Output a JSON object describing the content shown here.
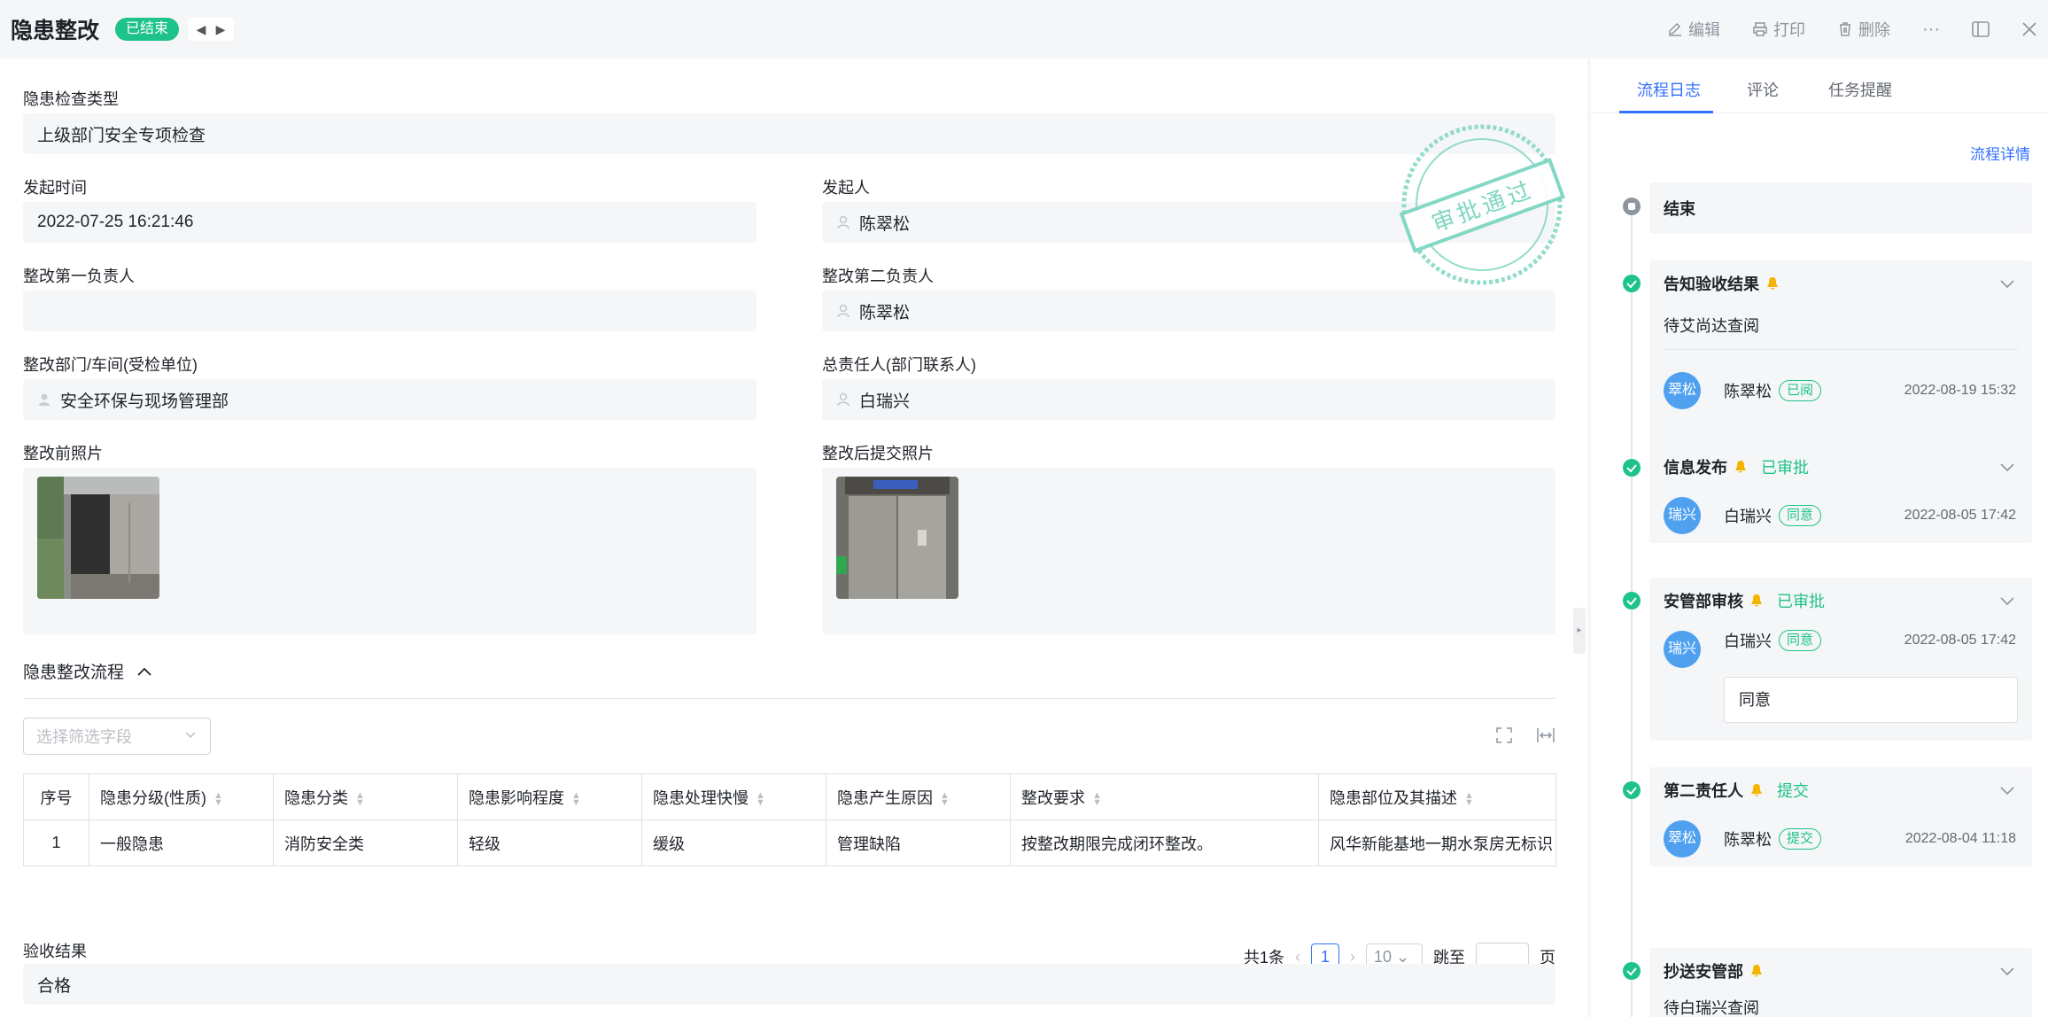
{
  "header": {
    "title": "隐患整改",
    "status": "已结束",
    "actions": {
      "edit": "编辑",
      "print": "打印",
      "delete": "删除"
    },
    "more": "···"
  },
  "form": {
    "check_type": {
      "label": "隐患检查类型",
      "value": "上级部门安全专项检查"
    },
    "start_time": {
      "label": "发起时间",
      "value": "2022-07-25 16:21:46"
    },
    "initiator": {
      "label": "发起人",
      "value": "陈翠松"
    },
    "first_owner": {
      "label": "整改第一负责人",
      "value": ""
    },
    "second_owner": {
      "label": "整改第二负责人",
      "value": "陈翠松"
    },
    "department": {
      "label": "整改部门/车间(受检单位)",
      "value": "安全环保与现场管理部"
    },
    "chief": {
      "label": "总责任人(部门联系人)",
      "value": "白瑞兴"
    },
    "before_photo": {
      "label": "整改前照片"
    },
    "after_photo": {
      "label": "整改后提交照片"
    },
    "acceptance": {
      "label": "验收结果",
      "value": "合格"
    }
  },
  "stamp": {
    "text": "审批通过"
  },
  "process_section": {
    "title": "隐患整改流程",
    "filter_placeholder": "选择筛选字段",
    "columns": [
      "序号",
      "隐患分级(性质)",
      "隐患分类",
      "隐患影响程度",
      "隐患处理快慢",
      "隐患产生原因",
      "整改要求",
      "隐患部位及其描述"
    ],
    "rows": [
      [
        "1",
        "一般隐患",
        "消防安全类",
        "轻级",
        "缓级",
        "管理缺陷",
        "按整改期限完成闭环整改。",
        "风华新能基地一期水泵房无标识"
      ]
    ]
  },
  "pager": {
    "total": "共1条",
    "current": "1",
    "page_size": "10",
    "jump": "跳至",
    "page_unit": "页"
  },
  "side": {
    "tabs": [
      "流程日志",
      "评论",
      "任务提醒"
    ],
    "flow_detail": "流程详情",
    "timeline": [
      {
        "title": "结束"
      },
      {
        "title": "告知验收结果",
        "pending": "待艾尚达查阅",
        "avatar": "翠松",
        "name": "陈翠松",
        "tag": "已阅",
        "time": "2022-08-19 15:32"
      },
      {
        "title": "信息发布",
        "status": "已审批",
        "avatar": "瑞兴",
        "name": "白瑞兴",
        "tag": "同意",
        "time": "2022-08-05 17:42"
      },
      {
        "title": "安管部审核",
        "status": "已审批",
        "avatar": "瑞兴",
        "name": "白瑞兴",
        "tag": "同意",
        "time": "2022-08-05 17:42",
        "comment": "同意"
      },
      {
        "title": "第二责任人",
        "status": "提交",
        "avatar": "翠松",
        "name": "陈翠松",
        "tag": "提交",
        "time": "2022-08-04 11:18"
      },
      {
        "title": "抄送安管部",
        "pending": "待白瑞兴查阅"
      }
    ]
  },
  "colors": {
    "accent": "#3370ff",
    "success": "#1ec28b",
    "avatar": "#4fa1f0"
  }
}
